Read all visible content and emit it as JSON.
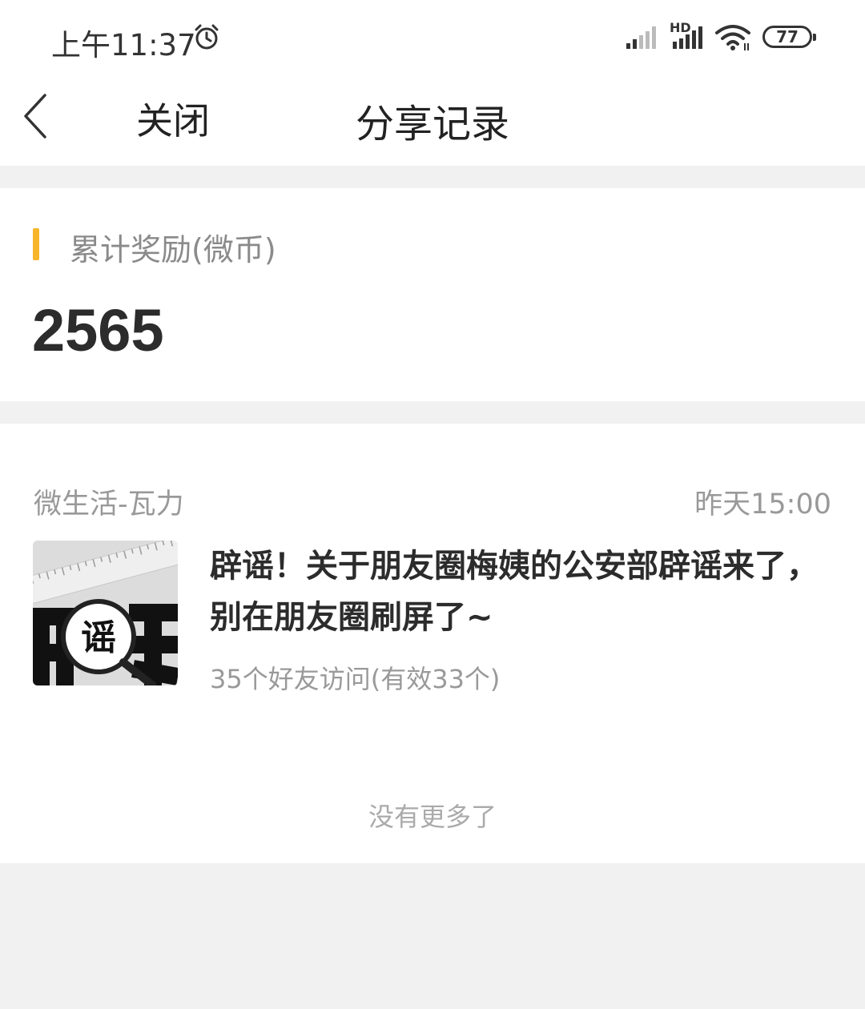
{
  "status_bar": {
    "time": "上午11:37",
    "network_label": "HD",
    "battery_level": "77",
    "icons": [
      "alarm-icon",
      "signal-icon",
      "signal-hd-icon",
      "wifi-icon",
      "battery-icon"
    ]
  },
  "nav": {
    "back_icon": "chevron-left-icon",
    "close_label": "关闭",
    "title": "分享记录"
  },
  "reward": {
    "label": "累计奖励(微币)",
    "value": "2565",
    "accent_color": "#f7b52b"
  },
  "records": [
    {
      "source": "微生活-瓦力",
      "time": "昨天15:00",
      "thumbnail_text": "谣",
      "title": "辟谣！关于朋友圈梅姨的公安部辟谣来了，别在朋友圈刷屏了~",
      "visits": "35个好友访问(有效33个)"
    }
  ],
  "footer": {
    "no_more": "没有更多了"
  }
}
